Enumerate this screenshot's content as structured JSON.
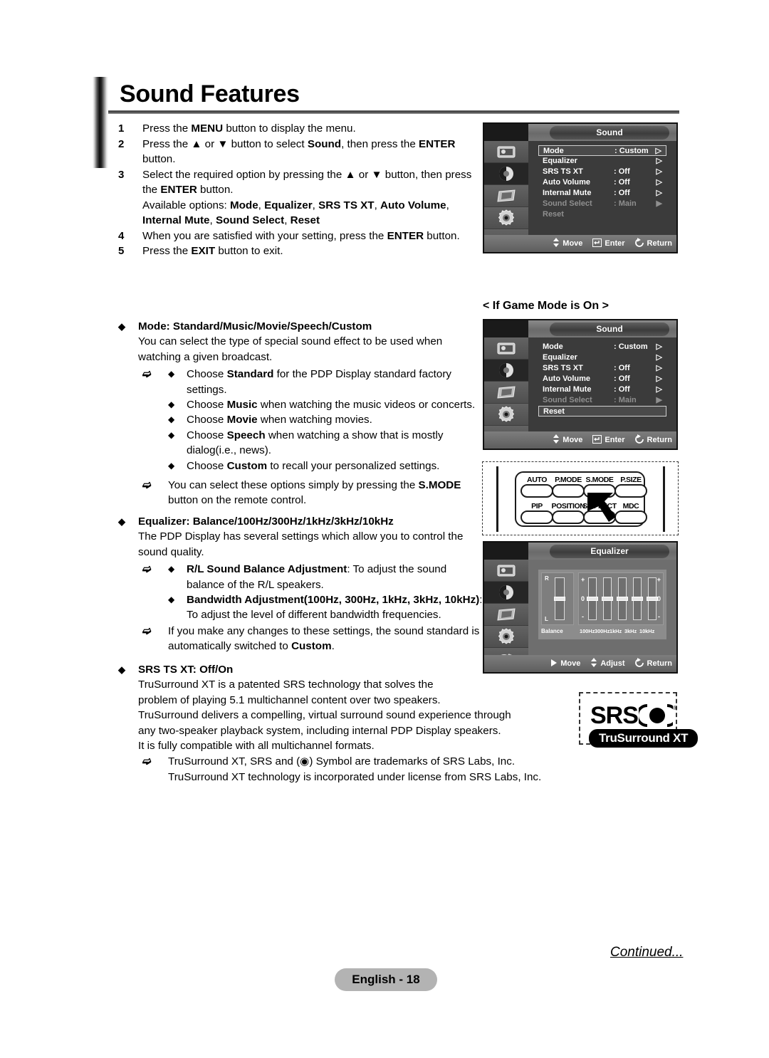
{
  "page": {
    "title": "Sound Features",
    "page_badge": "English - 18",
    "continued": "Continued..."
  },
  "steps": [
    {
      "num": "1",
      "text_html": "Press the <b>MENU</b> button to display the menu."
    },
    {
      "num": "2",
      "text_html": "Press the ▲ or ▼ button to select <b>Sound</b>, then press the <b>ENTER</b> button."
    },
    {
      "num": "3",
      "text_html": "Select the required option by pressing the ▲ or ▼ button, then press the <b>ENTER</b> button."
    },
    {
      "num": "",
      "text_html": "Available options: <b>Mode</b>, <b>Equalizer</b>, <b>SRS TS XT</b>, <b>Auto Volume</b>, <b>Internal Mute</b>, <b>Sound Select</b>, <b>Reset</b>"
    },
    {
      "num": "4",
      "text_html": "When you are satisfied with your setting, press the <b>ENTER</b> button."
    },
    {
      "num": "5",
      "text_html": "Press the <b>EXIT</b> button to exit."
    }
  ],
  "features": {
    "mode": {
      "heading_html": "<b>Mode</b>: Standard/Music/Movie/Speech/Custom",
      "body": "You can select the type of special sound effect to be used when watching a given broadcast.",
      "choices": [
        "Choose <b>Standard</b> for the PDP Display standard factory settings.",
        "Choose <b>Music</b> when watching the music videos or concerts.",
        "Choose <b>Movie</b> when watching movies.",
        "Choose <b>Speech</b> when watching a show that is mostly dialog(i.e., news).",
        "Choose <b>Custom</b> to recall your personalized settings."
      ],
      "note": "You can select these options simply by pressing the <b>S.MODE</b> button on the remote control."
    },
    "equalizer": {
      "heading_html": "<b>Equalizer</b>: Balance/100Hz/300Hz/1kHz/3kHz/10kHz",
      "body": "The PDP Display has several settings which allow you to control the sound quality.",
      "items": [
        "<b>R/L Sound Balance Adjustment</b>: To adjust the sound balance of the R/L speakers.",
        "<b>Bandwidth Adjustment(100Hz, 300Hz, 1kHz, 3kHz, 10kHz)</b>: To adjust the level of different bandwidth frequencies."
      ],
      "note": "If you make any changes to these settings, the sound standard is automatically switched to <b>Custom</b>."
    },
    "srs": {
      "heading_html": "<b>SRS TS XT</b>: Off/On",
      "body_lines": [
        "TruSurround XT is a patented SRS technology that solves the",
        "problem of playing 5.1 multichannel content over two speakers.",
        "TruSurround delivers a compelling, virtual surround  sound experience through",
        "any two-speaker playback system, including internal PDP Display speakers.",
        "It is fully compatible with all multichannel formats."
      ],
      "note_lines": [
        "TruSurround XT, SRS and (◉) Symbol are trademarks of SRS Labs, Inc.",
        "TruSurround XT technology is incorporated under license from SRS Labs, Inc."
      ]
    }
  },
  "osd_sound": {
    "title": "Sound",
    "rows": [
      {
        "label": "Mode",
        "value": ": Custom",
        "arrow": "▷",
        "selected": true,
        "dim": false
      },
      {
        "label": "Equalizer",
        "value": "",
        "arrow": "▷",
        "selected": false,
        "dim": false
      },
      {
        "label": "SRS TS XT",
        "value": ": Off",
        "arrow": "▷",
        "selected": false,
        "dim": false
      },
      {
        "label": "Auto Volume",
        "value": ": Off",
        "arrow": "▷",
        "selected": false,
        "dim": false
      },
      {
        "label": "Internal Mute",
        "value": ": Off",
        "arrow": "▷",
        "selected": false,
        "dim": false
      },
      {
        "label": "Sound Select",
        "value": ": Main",
        "arrow": "▶",
        "selected": false,
        "dim": true
      },
      {
        "label": "Reset",
        "value": "",
        "arrow": "",
        "selected": false,
        "dim": true
      }
    ],
    "hints": [
      {
        "icon": "updown-arrow-icon",
        "label": "Move"
      },
      {
        "icon": "enter-key-icon",
        "label": "Enter"
      },
      {
        "icon": "return-arrow-icon",
        "label": "Return"
      }
    ],
    "sidebar_icons": [
      "picture-icon",
      "sound-icon",
      "screen-icon",
      "setup-icon",
      "input-icon"
    ]
  },
  "osd_game": {
    "caption": "< If Game Mode is On >",
    "title": "Sound",
    "rows": [
      {
        "label": "Mode",
        "value": ": Custom",
        "arrow": "▷",
        "selected": false,
        "dim": false
      },
      {
        "label": "Equalizer",
        "value": "",
        "arrow": "▷",
        "selected": false,
        "dim": false
      },
      {
        "label": "SRS TS XT",
        "value": ": Off",
        "arrow": "▷",
        "selected": false,
        "dim": false
      },
      {
        "label": "Auto Volume",
        "value": ": Off",
        "arrow": "▷",
        "selected": false,
        "dim": false
      },
      {
        "label": "Internal Mute",
        "value": ": Off",
        "arrow": "▷",
        "selected": false,
        "dim": false
      },
      {
        "label": "Sound Select",
        "value": ": Main",
        "arrow": "▶",
        "selected": false,
        "dim": true
      },
      {
        "label": "Reset",
        "value": "",
        "arrow": "",
        "selected": true,
        "dim": false
      }
    ],
    "hints": [
      {
        "icon": "updown-arrow-icon",
        "label": "Move"
      },
      {
        "icon": "enter-key-icon",
        "label": "Enter"
      },
      {
        "icon": "return-arrow-icon",
        "label": "Return"
      }
    ]
  },
  "osd_equalizer": {
    "title": "Equalizer",
    "balance_label": "Balance",
    "balance_top": "R",
    "balance_bottom": "L",
    "plus": "+",
    "minus": "-",
    "zero": "0",
    "bands": [
      "100Hz",
      "300Hz",
      "1kHz",
      "3kHz",
      "10kHz"
    ],
    "hints": [
      {
        "icon": "right-arrow-icon",
        "label": "Move"
      },
      {
        "icon": "updown-arrow-icon",
        "label": "Adjust"
      },
      {
        "icon": "return-arrow-icon",
        "label": "Return"
      }
    ]
  },
  "remote": {
    "row1": [
      "AUTO",
      "P.MODE",
      "S.MODE",
      "P.SIZE"
    ],
    "row2": [
      "PIP",
      "POSITION",
      "S.EFFECT",
      "MDC"
    ],
    "pointer": "cursor-arrow-icon"
  },
  "srs_logo": {
    "word": "SRS",
    "mark": "srs-circle-icon",
    "registered": "®",
    "pill": "TruSurround XT"
  }
}
